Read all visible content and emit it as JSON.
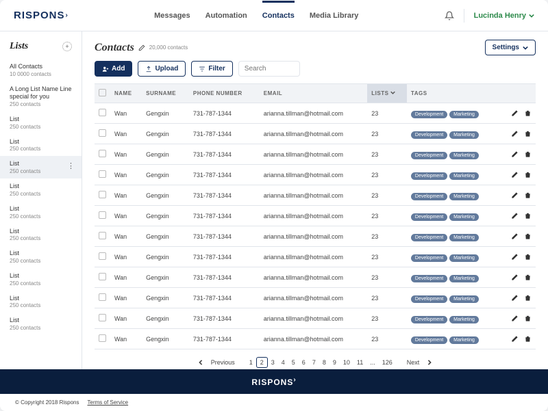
{
  "brand": "RISPONS",
  "nav": {
    "messages": "Messages",
    "automation": "Automation",
    "contacts": "Contacts",
    "media": "Media Library"
  },
  "user": {
    "name": "Lucinda Henry"
  },
  "sidebar": {
    "title": "Lists",
    "items": [
      {
        "label": "All Contacts",
        "count": "10 0000 contacts"
      },
      {
        "label": "A Long List Name Line special for you",
        "count": "250 contacts"
      },
      {
        "label": "List",
        "count": "250 contacts"
      },
      {
        "label": "List",
        "count": "250 contacts"
      },
      {
        "label": "List",
        "count": "250 contacts",
        "active": true
      },
      {
        "label": "List",
        "count": "250 contacts"
      },
      {
        "label": "List",
        "count": "250 contacts"
      },
      {
        "label": "List",
        "count": "250 contacts"
      },
      {
        "label": "List",
        "count": "250 contacts"
      },
      {
        "label": "List",
        "count": "250 contacts"
      },
      {
        "label": "List",
        "count": "250 contacts"
      },
      {
        "label": "List",
        "count": "250 contacts"
      }
    ]
  },
  "page": {
    "title": "Contacts",
    "count_label": "20,000 contacts",
    "settings_label": "Settings",
    "add_label": "Add",
    "upload_label": "Upload",
    "filter_label": "Filter",
    "search_placeholder": "Search"
  },
  "table": {
    "columns": {
      "name": "NAME",
      "surname": "SURNAME",
      "phone": "PHONE NUMBER",
      "email": "EMAIL",
      "lists": "LISTS",
      "tags": "TAGS"
    },
    "tags": [
      "Development",
      "Marketing"
    ],
    "row": {
      "name": "Wan",
      "surname": "Gengxin",
      "phone": "731-787-1344",
      "email": "arianna.tillman@hotmail.com",
      "lists": "23"
    },
    "row_count": 12
  },
  "pagination": {
    "prev": "Previous",
    "next": "Next",
    "pages": [
      "1",
      "2",
      "3",
      "4",
      "5",
      "6",
      "7",
      "8",
      "9",
      "10",
      "11",
      "...",
      "126"
    ],
    "active": "2"
  },
  "footer": {
    "copyright": "© Copyright 2018 Rispons",
    "tos": "Terms of Service"
  }
}
